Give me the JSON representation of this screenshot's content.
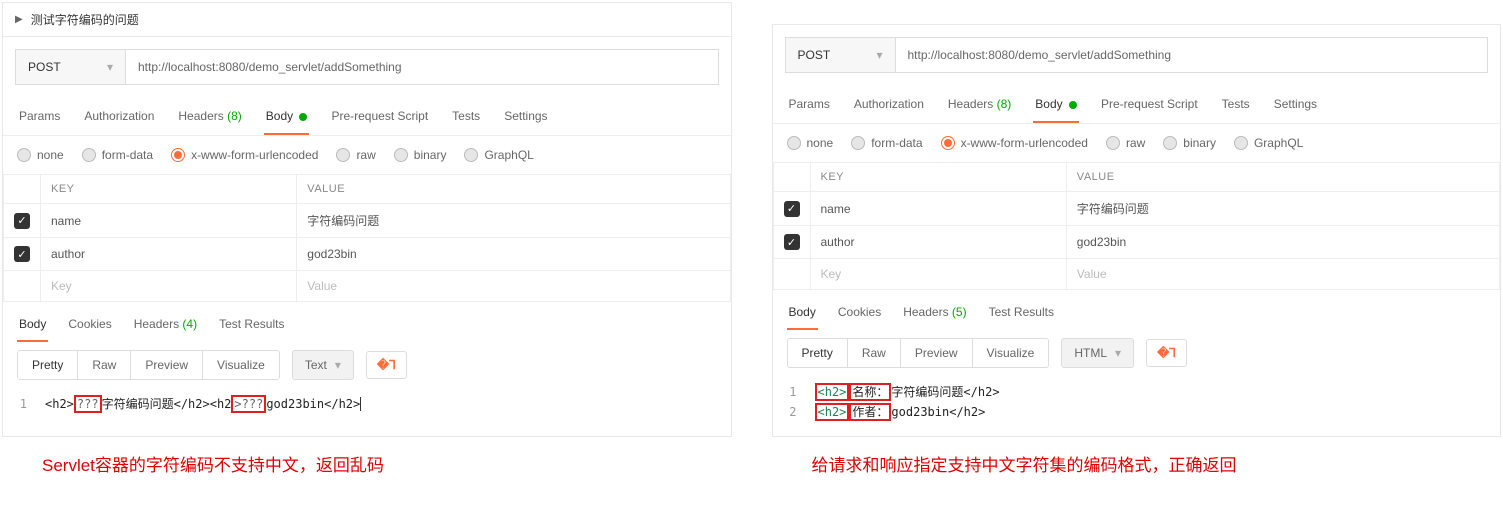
{
  "left": {
    "requestName": "测试字符编码的问题",
    "method": "POST",
    "url": "http://localhost:8080/demo_servlet/addSomething",
    "tabs": {
      "params": "Params",
      "auth": "Authorization",
      "headers": "Headers",
      "headersCount": "(8)",
      "body": "Body",
      "prs": "Pre-request Script",
      "tests": "Tests",
      "settings": "Settings"
    },
    "bodyTypes": {
      "none": "none",
      "form": "form-data",
      "url": "x-www-form-urlencoded",
      "raw": "raw",
      "bin": "binary",
      "gql": "GraphQL"
    },
    "table": {
      "hKey": "KEY",
      "hVal": "VALUE",
      "rows": [
        {
          "k": "name",
          "v": "字符编码问题"
        },
        {
          "k": "author",
          "v": "god23bin"
        }
      ],
      "phKey": "Key",
      "phVal": "Value"
    },
    "respTabs": {
      "body": "Body",
      "cookies": "Cookies",
      "headers": "Headers",
      "headersCount": "(4)",
      "tr": "Test Results"
    },
    "toolbar": {
      "pretty": "Pretty",
      "raw": "Raw",
      "preview": "Preview",
      "vis": "Visualize",
      "fmt": "Text"
    },
    "code": {
      "ln1": "1",
      "t1": "<h2>",
      "q1": "???",
      "s1": "字符编码问题</h2><h2",
      "b": ">",
      "q2": "???",
      "s2": "god23bin</h2>"
    },
    "caption": "Servlet容器的字符编码不支持中文，返回乱码"
  },
  "right": {
    "method": "POST",
    "url": "http://localhost:8080/demo_servlet/addSomething",
    "tabs": {
      "params": "Params",
      "auth": "Authorization",
      "headers": "Headers",
      "headersCount": "(8)",
      "body": "Body",
      "prs": "Pre-request Script",
      "tests": "Tests",
      "settings": "Settings"
    },
    "bodyTypes": {
      "none": "none",
      "form": "form-data",
      "url": "x-www-form-urlencoded",
      "raw": "raw",
      "bin": "binary",
      "gql": "GraphQL"
    },
    "table": {
      "hKey": "KEY",
      "hVal": "VALUE",
      "rows": [
        {
          "k": "name",
          "v": "字符编码问题"
        },
        {
          "k": "author",
          "v": "god23bin"
        }
      ],
      "phKey": "Key",
      "phVal": "Value"
    },
    "respTabs": {
      "body": "Body",
      "cookies": "Cookies",
      "headers": "Headers",
      "headersCount": "(5)",
      "tr": "Test Results"
    },
    "toolbar": {
      "pretty": "Pretty",
      "raw": "Raw",
      "preview": "Preview",
      "vis": "Visualize",
      "fmt": "HTML"
    },
    "code": {
      "ln1": "1",
      "ln2": "2",
      "l1t1": "<h2>",
      "l1h": "名称：",
      "l1s": "字符编码问题</h2>",
      "l2t1": "<h2>",
      "l2h": "作者：",
      "l2s": "god23bin</h2>"
    },
    "caption": "给请求和响应指定支持中文字符集的编码格式，正确返回"
  }
}
